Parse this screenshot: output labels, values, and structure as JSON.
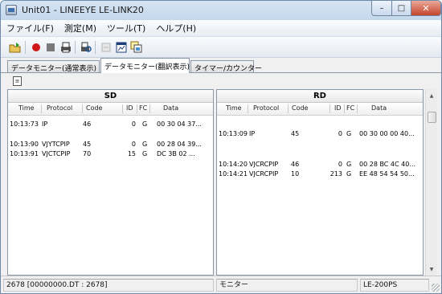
{
  "window": {
    "title": "Unit01 - LINEEYE LE-LINK20",
    "min_glyph": "–",
    "max_glyph": "□",
    "close_glyph": "✕"
  },
  "menu": [
    {
      "label": "ファイル(F)"
    },
    {
      "label": "測定(M)"
    },
    {
      "label": "ツール(T)"
    },
    {
      "label": "ヘルプ(H)"
    }
  ],
  "toolbar": {
    "icons": [
      "open-folder-icon",
      "record-icon",
      "stop-icon",
      "print-icon",
      "print-preview-icon",
      "disabled-icon",
      "window-icon",
      "copy-windows-icon"
    ],
    "colors": {
      "record": "#d01818",
      "stop": "#7a7a7a"
    }
  },
  "tabs": [
    {
      "label": "データモニター(通常表示)",
      "active": false
    },
    {
      "label": "データモニター(翻訳表示)",
      "active": true
    },
    {
      "label": "タイマー/カウンター",
      "active": false
    }
  ],
  "columns": [
    "Time",
    "Protocol",
    "Code",
    "ID",
    "FC",
    "Data"
  ],
  "sd": {
    "title": "SD",
    "rows": [
      {
        "time": "10:13:73",
        "protocol": "IP",
        "code": "46",
        "id": "0",
        "fc": "G",
        "data": "00 30 04 37..."
      },
      {
        "time": "10:13:90",
        "protocol": "VJYTCPIP",
        "code": "45",
        "id": "0",
        "fc": "G",
        "data": "00 28 04 39..."
      },
      {
        "time": "10:13:91",
        "protocol": "VJCTCPIP",
        "code": "70",
        "id": "15",
        "fc": "G",
        "data": "DC 3B 02 ..."
      }
    ]
  },
  "rd": {
    "title": "RD",
    "rows": [
      {
        "time": "10:13:09",
        "protocol": "IP",
        "code": "45",
        "id": "0",
        "fc": "G",
        "data": "00 30 00 00 40..."
      },
      {
        "time": "10:14:20",
        "protocol": "VJCRCPIP",
        "code": "46",
        "id": "0",
        "fc": "G",
        "data": "00 28 BC 4C 40..."
      },
      {
        "time": "10:14:21",
        "protocol": "VJCRCPIP",
        "code": "10",
        "id": "213",
        "fc": "G",
        "data": "EE 48 54 54 50..."
      }
    ]
  },
  "status": {
    "left": "2678 [00000000.DT : 2678]",
    "middle": "モニター",
    "right": "LE-200PS"
  }
}
